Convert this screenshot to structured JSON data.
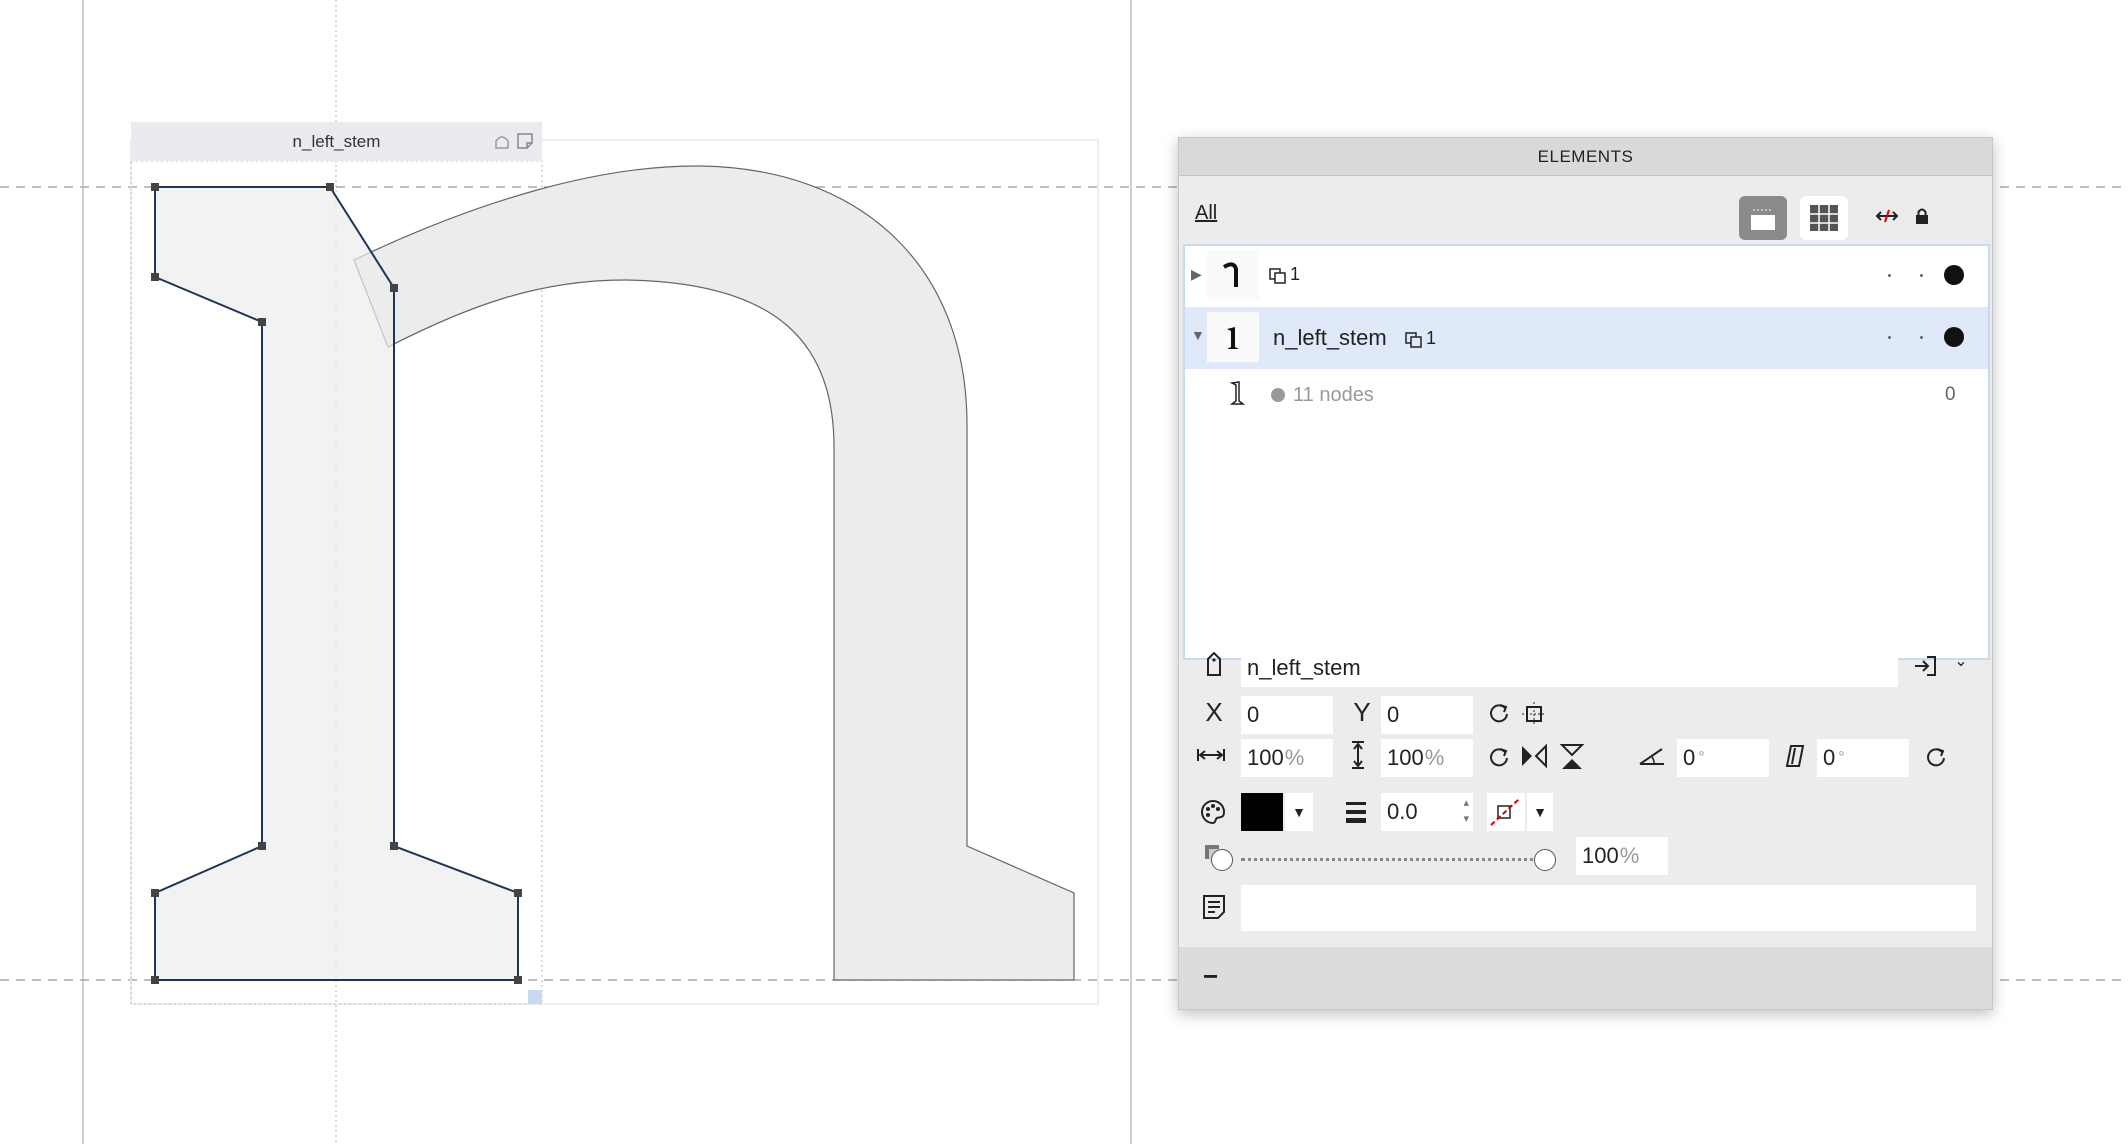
{
  "canvas": {
    "selection_label": "n_left_stem"
  },
  "panel": {
    "title": "ELEMENTS",
    "filter_label": "All",
    "rows": [
      {
        "name": "",
        "component_count": "1",
        "expanded": false
      },
      {
        "name": "n_left_stem",
        "component_count": "1",
        "expanded": true
      },
      {
        "name": "11 nodes",
        "value": "0"
      }
    ],
    "properties": {
      "name": "n_left_stem",
      "x_label": "X",
      "x": "0",
      "y_label": "Y",
      "y": "0",
      "width": "100",
      "height": "100",
      "percent_unit": "%",
      "slant": "0",
      "skew": "0",
      "degree_unit": "°",
      "stroke_width": "0.0",
      "opacity": "100",
      "note": ""
    },
    "footer_minus": "−"
  },
  "colors": {
    "fill": "#000000",
    "outline": "#1d3557",
    "glyph_fill": "#ececec",
    "selected_row": "#dfe9f9"
  }
}
